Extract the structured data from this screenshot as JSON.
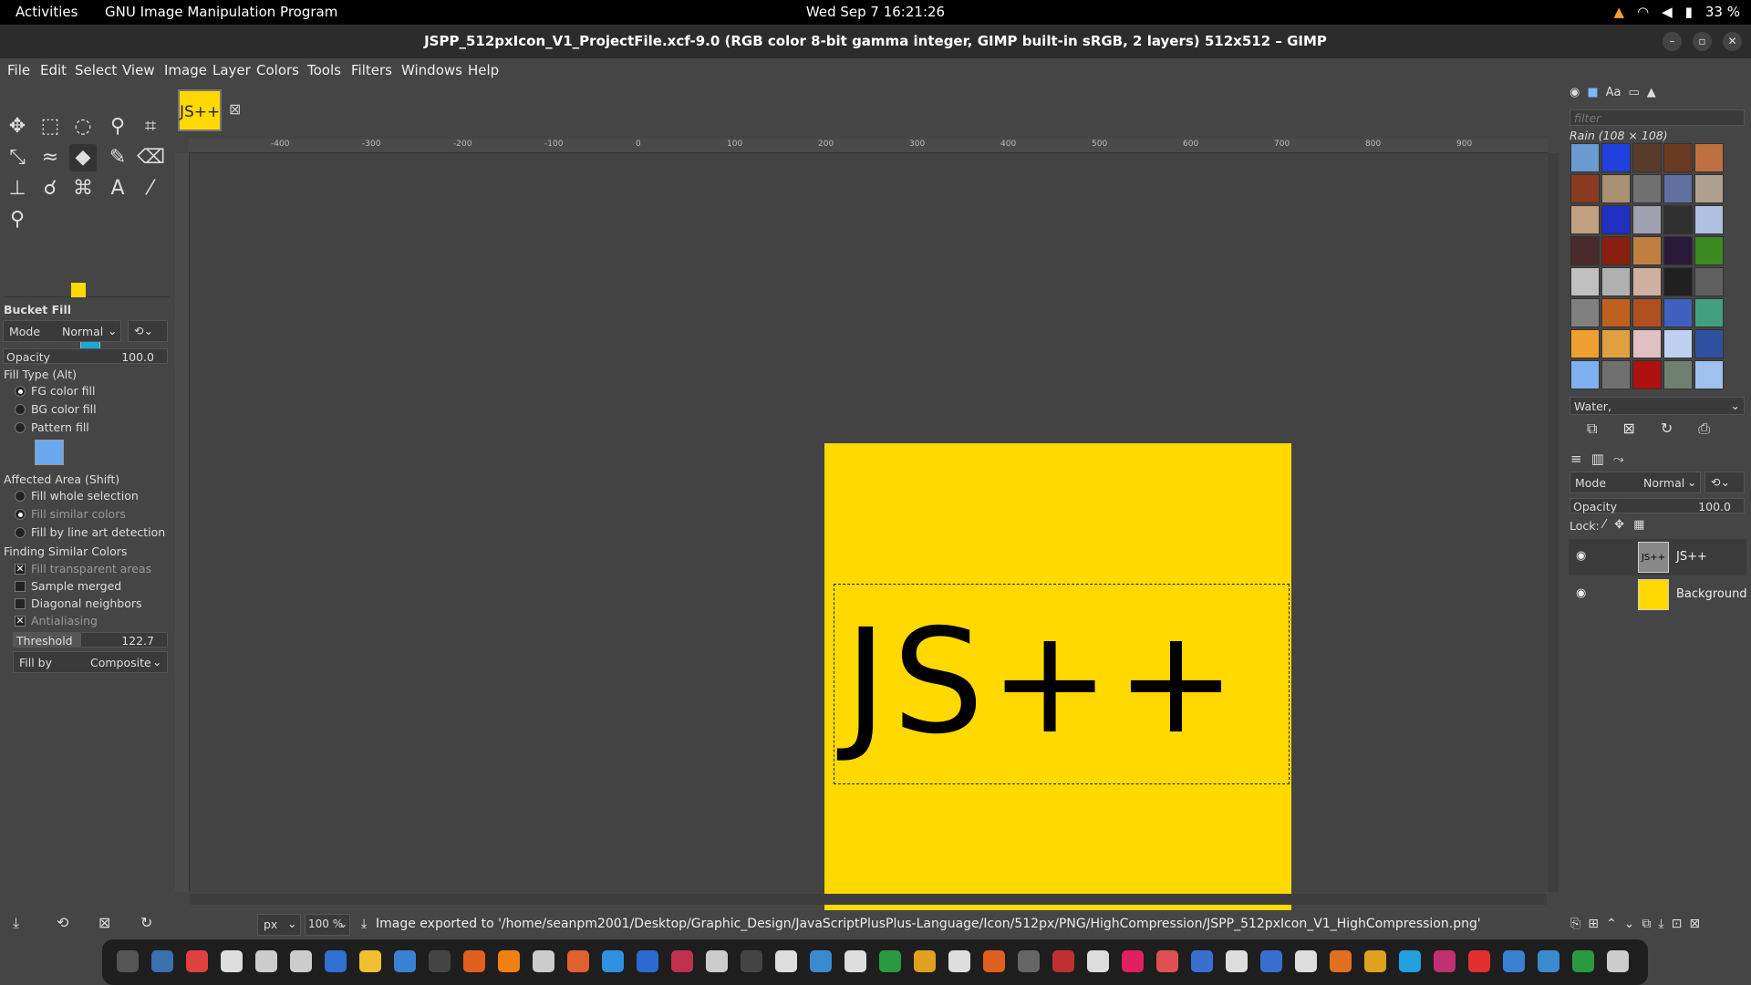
{
  "topbar": {
    "activities": "Activities",
    "app_name": "GNU Image Manipulation Program",
    "clock": "Wed Sep 7  16:21:26",
    "battery": "33 %"
  },
  "window": {
    "title": "JSPP_512pxIcon_V1_ProjectFile.xcf-9.0 (RGB color 8-bit gamma integer, GIMP built-in sRGB, 2 layers) 512x512 – GIMP"
  },
  "menu": [
    "File",
    "Edit",
    "Select",
    "View",
    "Image",
    "Layer",
    "Colors",
    "Tools",
    "Filters",
    "Windows",
    "Help"
  ],
  "image_tab": {
    "label": "JS++"
  },
  "canvas": {
    "image_text": "JS++",
    "image_bg": "#ffd900"
  },
  "ruler_labels": [
    "-400",
    "-300",
    "-200",
    "-100",
    "0",
    "100",
    "200",
    "300",
    "400",
    "500",
    "600",
    "700",
    "800",
    "900"
  ],
  "tool_options": {
    "title": "Bucket Fill",
    "mode_label": "Mode",
    "mode_value": "Normal",
    "opacity_label": "Opacity",
    "opacity_value": "100.0",
    "fill_type_label": "Fill Type  (Alt)",
    "fill_types": [
      "FG color fill",
      "BG color fill",
      "Pattern fill"
    ],
    "affected_area_label": "Affected Area  (Shift)",
    "affected_areas": [
      "Fill whole selection",
      "Fill similar colors",
      "Fill by line art detection"
    ],
    "finding_label": "Finding Similar Colors",
    "finding_options": [
      "Fill transparent areas",
      "Sample merged",
      "Diagonal neighbors",
      "Antialiasing"
    ],
    "threshold_label": "Threshold",
    "threshold_value": "122.7",
    "fill_by_label": "Fill by",
    "fill_by_value": "Composite"
  },
  "status": {
    "unit": "px",
    "zoom": "100 %",
    "message": "Image exported to '/home/seanpm2001/Desktop/Graphic_Design/JavaScriptPlusPlus-Language/Icon/512px/PNG/HighCompression/JSPP_512pxIcon_V1_HighCompression.png'"
  },
  "patterns_panel": {
    "filter_placeholder": "filter",
    "header": "Rain (108 × 108)",
    "selected": "Water,"
  },
  "layers_panel": {
    "mode_label": "Mode",
    "mode_value": "Normal",
    "opacity_label": "Opacity",
    "opacity_value": "100.0",
    "lock_label": "Lock:",
    "layers": [
      {
        "name": "JS++"
      },
      {
        "name": "Background"
      }
    ]
  }
}
